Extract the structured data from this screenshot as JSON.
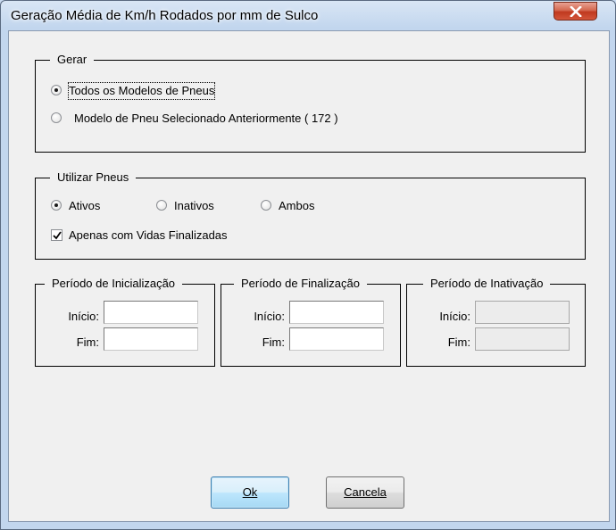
{
  "window": {
    "title": "Geração Média de Km/h Rodados por mm de Sulco",
    "close_icon": "close-icon"
  },
  "gerar": {
    "legend": "Gerar",
    "options": [
      {
        "label": "Todos os Modelos de Pneus",
        "selected": true
      },
      {
        "label": "Modelo de Pneu Selecionado Anteriormente ( 172 )",
        "selected": false
      }
    ]
  },
  "utilizar": {
    "legend": "Utilizar Pneus",
    "options": [
      {
        "label": "Ativos",
        "selected": true
      },
      {
        "label": "Inativos",
        "selected": false
      },
      {
        "label": "Ambos",
        "selected": false
      }
    ],
    "checkbox": {
      "label": "Apenas com Vidas Finalizadas",
      "checked": true
    }
  },
  "periodos": [
    {
      "legend": "Período de Inicialização",
      "inicio_label": "Início:",
      "fim_label": "Fim:",
      "inicio_value": "",
      "fim_value": "",
      "enabled": true
    },
    {
      "legend": "Período de Finalização",
      "inicio_label": "Início:",
      "fim_label": "Fim:",
      "inicio_value": "",
      "fim_value": "",
      "enabled": true
    },
    {
      "legend": "Período de Inativação",
      "inicio_label": "Início:",
      "fim_label": "Fim:",
      "inicio_value": "",
      "fim_value": "",
      "enabled": false
    }
  ],
  "buttons": {
    "ok_label": "Ok",
    "cancel_label": "Cancela"
  }
}
